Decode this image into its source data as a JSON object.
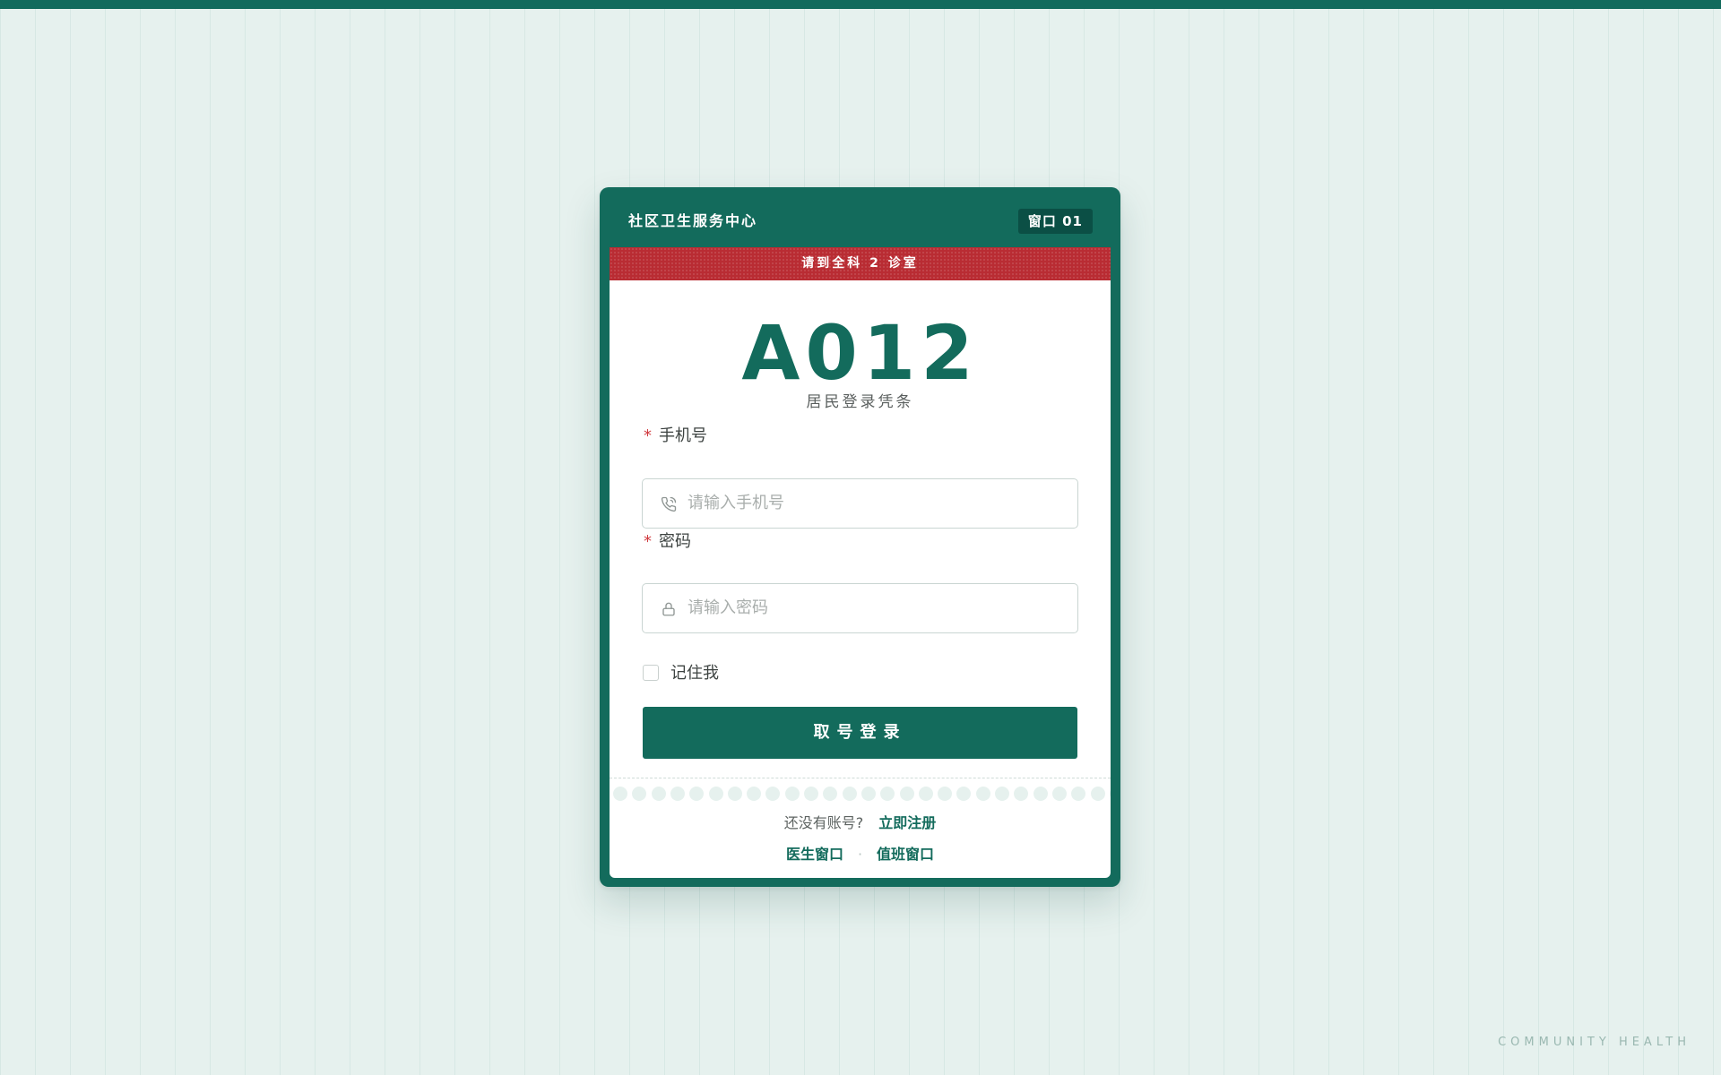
{
  "header": {
    "center_name": "社区卫生服务中心",
    "window_badge": "窗口 01"
  },
  "banner": {
    "text": "请到全科 2 诊室"
  },
  "ticket": {
    "queue_number": "A012",
    "subtitle": "居民登录凭条"
  },
  "form": {
    "phone": {
      "required_mark": "*",
      "label": "手机号",
      "placeholder": "请输入手机号",
      "value": "",
      "icon": "phone-icon"
    },
    "password": {
      "required_mark": "*",
      "label": "密码",
      "placeholder": "请输入密码",
      "value": "",
      "icon": "lock-icon"
    },
    "remember": {
      "label": "记住我",
      "checked": false
    },
    "submit_label": "取号登录"
  },
  "footer": {
    "no_account_text": "还没有账号?",
    "register_link": "立即注册",
    "doctor_link": "医生窗口",
    "separator": "·",
    "duty_link": "值班窗口"
  },
  "corner_brand": "COMMUNITY HEALTH",
  "colors": {
    "primary": "#136b5c",
    "banner_red": "#b92c33",
    "background": "#e6f1ee",
    "required": "#d03a3f"
  }
}
